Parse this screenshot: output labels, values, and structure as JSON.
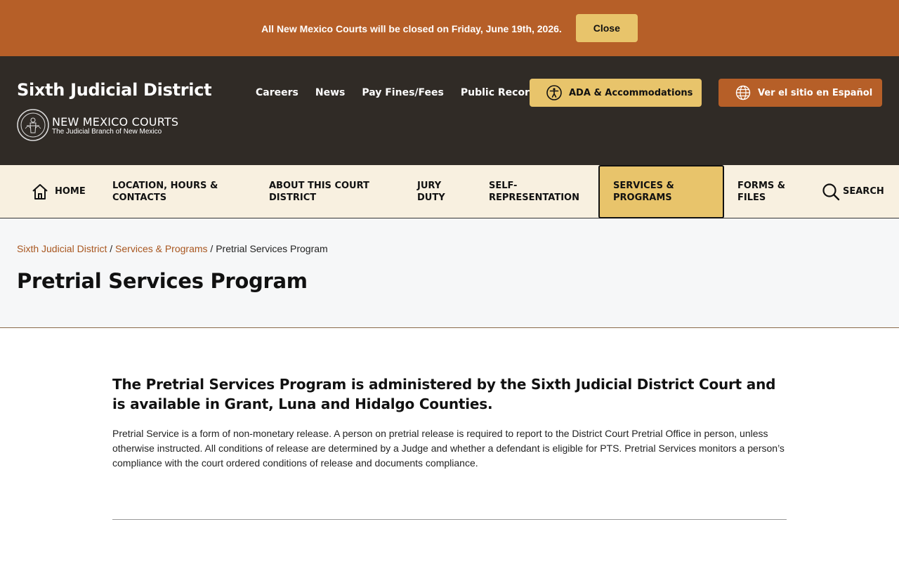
{
  "alert": {
    "message": "All New Mexico Courts will be closed on Friday, June 19th, 2026.",
    "close_label": "Close"
  },
  "header": {
    "site_title": "Sixth Judicial District",
    "brand_name": "NEW MEXICO COURTS",
    "brand_tagline": "The Judicial Branch of New Mexico",
    "utility_links": [
      "Careers",
      "News",
      "Pay Fines/Fees",
      "Public Records"
    ],
    "ada_label": "ADA & Accommodations",
    "spanish_label": "Ver el sitio en Español"
  },
  "nav": {
    "home": "HOME",
    "location": "LOCATION, HOURS & CONTACTS",
    "about": "ABOUT THIS COURT DISTRICT",
    "jury": "JURY DUTY",
    "self_rep": "SELF-REPRESENTATION",
    "services": "SERVICES & PROGRAMS",
    "forms": "FORMS & FILES",
    "search": "SEARCH"
  },
  "breadcrumb": {
    "home": "Sixth Judicial District",
    "parent": "Services & Programs",
    "current": "Pretrial Services Program",
    "separator": "/"
  },
  "page": {
    "title": "Pretrial Services Program",
    "lead": "The Pretrial Services Program is administered by the Sixth Judicial District Court and is available in Grant, Luna and Hidalgo Counties.",
    "body": "Pretrial Service is a form of non-monetary release. A person on pretrial release is required to report to the District Court Pretrial Office in person, unless otherwise instructed. All conditions of release are determined by a Judge and whether a defendant is eligible for PTS. Pretrial Services monitors a person’s compliance with the court ordered conditions of release and documents compliance."
  },
  "colors": {
    "accent_orange": "#b65f28",
    "accent_gold": "#e8c46b",
    "header_dark": "#302b26",
    "nav_cream": "#f8f0e0"
  },
  "icons": {
    "home": "home-icon",
    "search": "search-icon",
    "accessibility": "accessibility-icon",
    "globe": "globe-icon",
    "seal": "court-seal-icon"
  }
}
